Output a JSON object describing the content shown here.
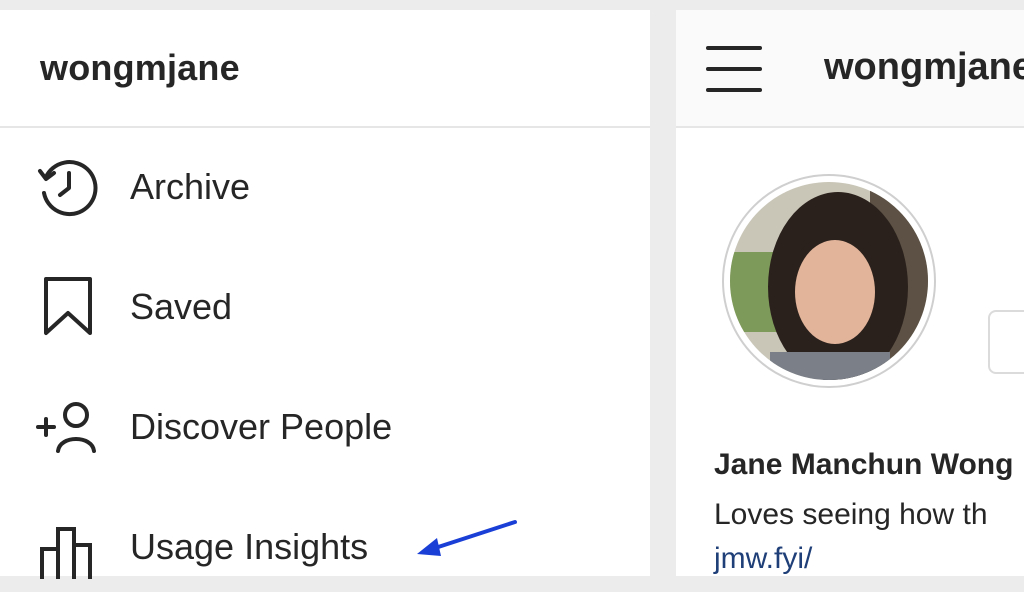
{
  "menu": {
    "username": "wongmjane",
    "items": [
      {
        "label": "Archive",
        "icon": "archive-history-icon"
      },
      {
        "label": "Saved",
        "icon": "bookmark-icon"
      },
      {
        "label": "Discover People",
        "icon": "add-person-icon"
      },
      {
        "label": "Usage Insights",
        "icon": "bar-chart-icon"
      }
    ]
  },
  "profile": {
    "header_username": "wongmjane",
    "full_name": "Jane Manchun Wong",
    "bio": "Loves seeing how th",
    "link": "jmw.fyi/"
  },
  "annotation": {
    "color": "#1a3fd6",
    "icon": "blue-arrow-pointer"
  }
}
